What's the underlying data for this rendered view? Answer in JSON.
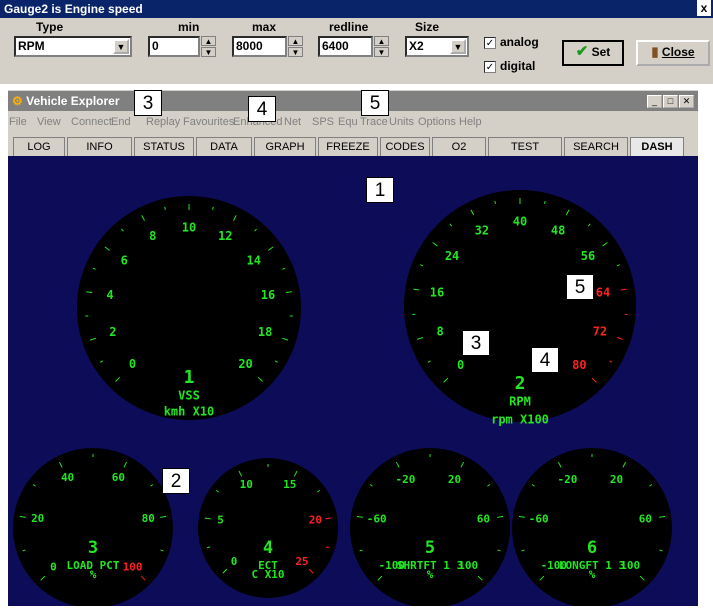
{
  "dialog": {
    "title": "Gauge2 is  Engine speed",
    "close_glyph": "x",
    "type_label": "Type",
    "type_value": "RPM",
    "min_label": "min",
    "min_value": "0",
    "max_label": "max",
    "max_value": "8000",
    "redline_label": "redline",
    "redline_value": "6400",
    "size_label": "Size",
    "size_value": "X2",
    "analog_label": "analog",
    "analog_checked": true,
    "digital_label": "digital",
    "digital_checked": true,
    "set_label": "Set",
    "close_label": "Close"
  },
  "window": {
    "title": "Vehicle Explorer",
    "menu": [
      "File",
      "View",
      "Connect",
      "End",
      "Replay",
      "Favourites",
      "Enhanced",
      "Net",
      "SPS",
      "Equ",
      "Trace",
      "Units",
      "Options",
      "Help"
    ],
    "tabs": [
      "LOG",
      "INFO",
      "STATUS",
      "DATA",
      "GRAPH",
      "FREEZE",
      "CODES",
      "O2",
      "TEST",
      "SEARCH",
      "DASH"
    ],
    "active_tab": "DASH"
  },
  "gauges": [
    {
      "id": "vss",
      "labels": [
        "0",
        "2",
        "4",
        "6",
        "8",
        "10",
        "12",
        "14",
        "16",
        "18",
        "20"
      ],
      "red_from": 99,
      "digital": "1",
      "name": "VSS",
      "units": "kmh X10"
    },
    {
      "id": "rpm",
      "labels": [
        "0",
        "8",
        "16",
        "24",
        "32",
        "40",
        "48",
        "56",
        "64",
        "72",
        "80"
      ],
      "red_from": 8,
      "digital": "2",
      "name": "RPM",
      "units": "rpm X100"
    },
    {
      "id": "load",
      "labels": [
        "0",
        "20",
        "40",
        "60",
        "80",
        "100"
      ],
      "red_from": 5,
      "digital": "3",
      "name": "LOAD_PCT",
      "units": "%"
    },
    {
      "id": "ect",
      "labels": [
        "0",
        "5",
        "10",
        "15",
        "20",
        "25"
      ],
      "red_from": 4,
      "digital": "4",
      "name": "ECT",
      "units": "C X10"
    },
    {
      "id": "shrtft",
      "labels": [
        "-100",
        "-60",
        "-20",
        "20",
        "60",
        "100"
      ],
      "red_from": 99,
      "digital": "5",
      "name": "SHRTFT_1_3",
      "units": "%"
    },
    {
      "id": "longft",
      "labels": [
        "-100",
        "-60",
        "-20",
        "20",
        "60",
        "100"
      ],
      "red_from": 99,
      "digital": "6",
      "name": "LONGFT_1_3",
      "units": "%"
    }
  ],
  "callouts": [
    "1",
    "2",
    "3",
    "4",
    "5",
    "3",
    "4",
    "5"
  ],
  "colors": {
    "dash_bg": "#0c0c58",
    "gauge_face": "#000000",
    "gauge_green": "#22e622",
    "gauge_red": "#ff2020",
    "title_bar": "#0a246a"
  }
}
